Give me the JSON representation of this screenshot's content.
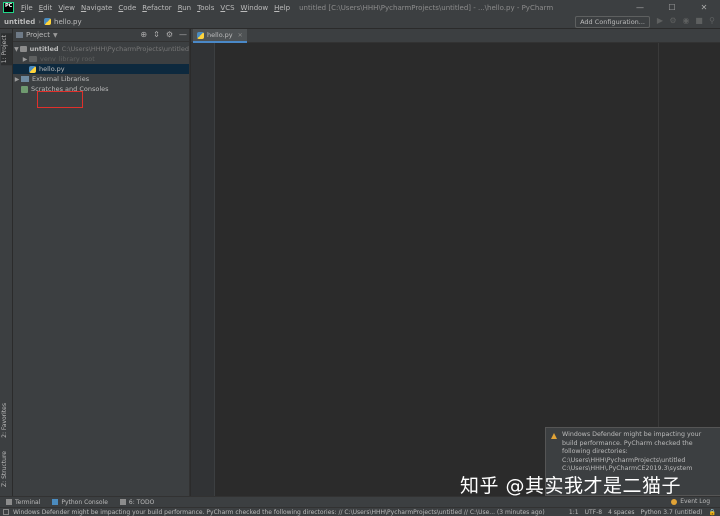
{
  "menu": {
    "items": [
      "File",
      "Edit",
      "View",
      "Navigate",
      "Code",
      "Refactor",
      "Run",
      "Tools",
      "VCS",
      "Window",
      "Help"
    ],
    "window_title": "untitled [C:\\Users\\HHH\\PycharmProjects\\untitled] - ...\\hello.py - PyCharm"
  },
  "navbar": {
    "project": "untitled",
    "file": "hello.py",
    "add_config": "Add Configuration..."
  },
  "left_strip": {
    "project_tab": "1: Project",
    "favorites_tab": "2: Favorites",
    "structure_tab": "Z: Structure"
  },
  "project_panel": {
    "title": "Project",
    "tree": {
      "root_name": "untitled",
      "root_path": "C:\\Users\\HHH\\PycharmProjects\\untitled",
      "venv_name": "venv",
      "venv_note": "library root",
      "file_name": "hello.py",
      "external_libs": "External Libraries",
      "scratches": "Scratches and Consoles"
    }
  },
  "editor": {
    "tab_label": "hello.py"
  },
  "notification": {
    "lines": [
      "Windows Defender might be impacting your",
      "build performance. PyCharm checked the",
      "following directories:",
      "C:\\Users\\HHH\\PycharmProjects\\untitled",
      "C:\\Users\\HHH\\.PyCharmCE2019.3\\system"
    ]
  },
  "watermark": "知乎 @其实我才是二猫子",
  "bottom_tools": {
    "terminal": "Terminal",
    "python_console": "Python Console",
    "todo": "6: TODO",
    "event_log": "Event Log"
  },
  "status": {
    "message": "Windows Defender might be impacting your build performance. PyCharm checked the following directories: // C:\\Users\\HHH\\PycharmProjects\\untitled // C:\\Use... (3 minutes ago)",
    "position": "1:1",
    "encoding": "UTF-8",
    "indent": "4 spaces",
    "interpreter": "Python 3.7 (untitled)"
  }
}
